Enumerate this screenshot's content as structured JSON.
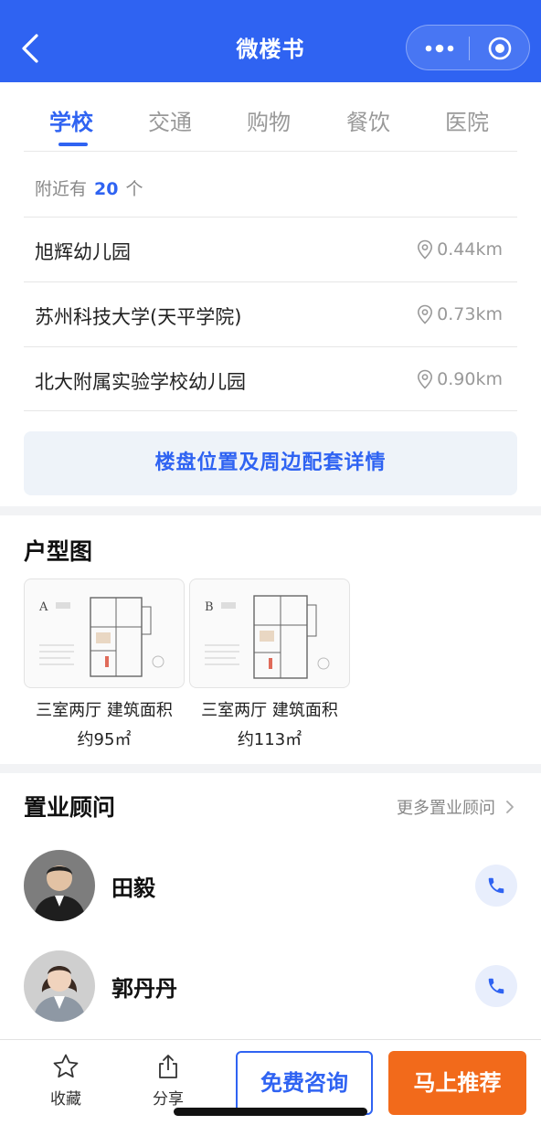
{
  "header": {
    "title": "微楼书"
  },
  "tabs": [
    {
      "label": "学校"
    },
    {
      "label": "交通"
    },
    {
      "label": "购物"
    },
    {
      "label": "餐饮"
    },
    {
      "label": "医院"
    }
  ],
  "nearby": {
    "prefix": "附近有",
    "count": "20",
    "suffix": "个"
  },
  "places": [
    {
      "name": "旭辉幼儿园",
      "distance": "0.44km"
    },
    {
      "name": "苏州科技大学(天平学院)",
      "distance": "0.73km"
    },
    {
      "name": "北大附属实验学校幼儿园",
      "distance": "0.90km"
    }
  ],
  "detail_button": "楼盘位置及周边配套详情",
  "floor_plans": {
    "title": "户型图",
    "items": [
      {
        "caption": "三室两厅 建筑面积",
        "area": "约95㎡"
      },
      {
        "caption": "三室两厅 建筑面积",
        "area": "约113㎡"
      }
    ]
  },
  "advisors": {
    "title": "置业顾问",
    "more": "更多置业顾问",
    "items": [
      {
        "name": "田毅"
      },
      {
        "name": "郭丹丹"
      }
    ]
  },
  "bottom_bar": {
    "favorite": "收藏",
    "share": "分享",
    "consult": "免费咨询",
    "recommend": "马上推荐"
  },
  "colors": {
    "primary": "#2f63f2",
    "accent": "#f26a1b"
  }
}
